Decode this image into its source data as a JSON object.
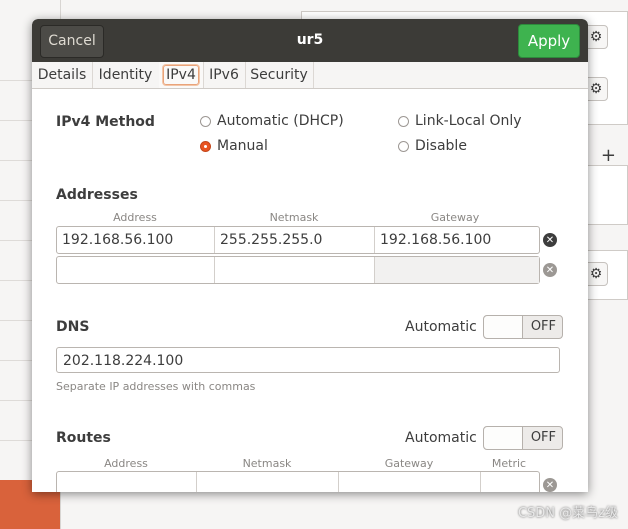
{
  "dialog": {
    "title": "ur5",
    "cancel_label": "Cancel",
    "apply_label": "Apply"
  },
  "tabs": [
    {
      "label": "Details",
      "active": false
    },
    {
      "label": "Identity",
      "active": false
    },
    {
      "label": "IPv4",
      "active": true
    },
    {
      "label": "IPv6",
      "active": false
    },
    {
      "label": "Security",
      "active": false
    }
  ],
  "ipv4": {
    "method_label": "IPv4 Method",
    "methods": [
      {
        "label": "Automatic (DHCP)",
        "selected": false
      },
      {
        "label": "Link-Local Only",
        "selected": false
      },
      {
        "label": "Manual",
        "selected": true
      },
      {
        "label": "Disable",
        "selected": false
      }
    ],
    "addresses": {
      "label": "Addresses",
      "columns": [
        "Address",
        "Netmask",
        "Gateway"
      ],
      "rows": [
        [
          "192.168.56.100",
          "255.255.255.0",
          "192.168.56.100"
        ],
        [
          "",
          "",
          ""
        ]
      ]
    },
    "dns": {
      "label": "DNS",
      "automatic_label": "Automatic",
      "toggle_state": "OFF",
      "value": "202.118.224.100",
      "hint": "Separate IP addresses with commas"
    },
    "routes": {
      "label": "Routes",
      "automatic_label": "Automatic",
      "toggle_state": "OFF",
      "columns": [
        "Address",
        "Netmask",
        "Gateway",
        "Metric"
      ]
    }
  },
  "background": {
    "gear_icon": "gear-icon",
    "plus_icon": "plus-icon"
  },
  "watermark": "CSDN @菜鸟z级",
  "colors": {
    "titlebar": "#3c3b37",
    "apply": "#3eb34f",
    "radio_selected": "#e95420",
    "accent_strip": "#d9623b"
  }
}
